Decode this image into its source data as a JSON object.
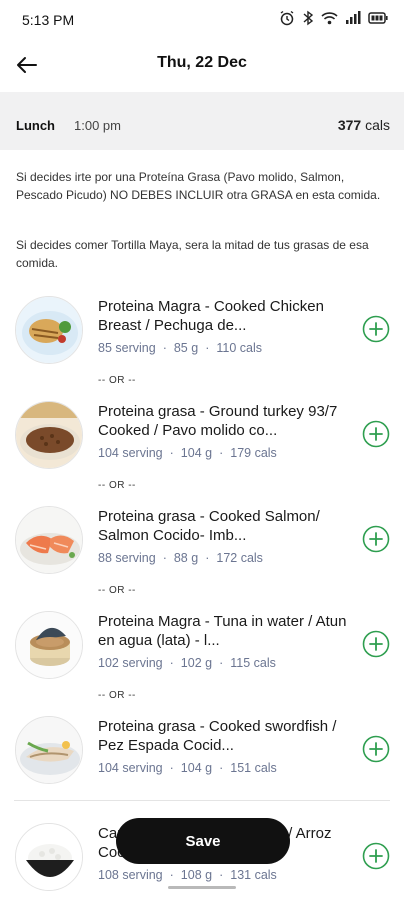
{
  "status_bar": {
    "time": "5:13 PM"
  },
  "header": {
    "title": "Thu, 22 Dec"
  },
  "meal": {
    "name": "Lunch",
    "time": "1:00 pm",
    "cals_value": "377",
    "cals_unit": "cals"
  },
  "notes": [
    "Si decides irte por una Proteína Grasa (Pavo molido, Salmon, Pescado Picudo)  NO DEBES INCLUIR otra GRASA en esta comida.",
    "Si decides comer Tortilla Maya, sera la mitad de tus grasas de esa comida."
  ],
  "or_label": "-- OR --",
  "foods": [
    {
      "name": "Proteina Magra - Cooked Chicken Breast / Pechuga de...",
      "serving": "85 serving",
      "grams": "85 g",
      "cals": "110 cals",
      "icon": "chicken-breast"
    },
    {
      "name": "Proteina grasa - Ground turkey 93/7 Cooked / Pavo molido co...",
      "serving": "104 serving",
      "grams": "104 g",
      "cals": "179 cals",
      "icon": "ground-turkey"
    },
    {
      "name": "Proteina grasa - Cooked Salmon/ Salmon Cocido- Imb...",
      "serving": "88 serving",
      "grams": "88 g",
      "cals": "172 cals",
      "icon": "salmon"
    },
    {
      "name": "Proteina Magra -  Tuna in water / Atun en agua (lata) - l...",
      "serving": "102 serving",
      "grams": "102 g",
      "cals": "115 cals",
      "icon": "tuna-can"
    },
    {
      "name": "Proteina grasa - Cooked swordfish / Pez Espada Cocid...",
      "serving": "104 serving",
      "grams": "104 g",
      "cals": "151 cals",
      "icon": "swordfish"
    },
    {
      "name": "Carbohidrato - Cooked Rice / Arroz Cocido",
      "serving": "108 serving",
      "grams": "108 g",
      "cals": "131 cals",
      "icon": "rice-bowl"
    }
  ],
  "save_label": "Save",
  "colors": {
    "accent_green": "#2e9e4f",
    "meta_blue": "#6b7591",
    "header_bg": "#f1f1f2"
  }
}
